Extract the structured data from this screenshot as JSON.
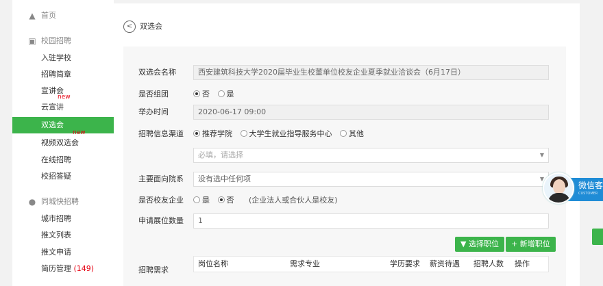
{
  "sidebar": {
    "home": "首页",
    "campus_group": "校园招聘",
    "items": [
      {
        "label": "入驻学校"
      },
      {
        "label": "招聘简章"
      },
      {
        "label": "宣讲会"
      },
      {
        "label": "云宣讲",
        "badge": "new"
      },
      {
        "label": "双选会"
      },
      {
        "label": "视频双选会",
        "badge": "new"
      },
      {
        "label": "在线招聘"
      },
      {
        "label": "校招答疑"
      }
    ],
    "city_group": "同城快招聘",
    "city_items": [
      {
        "label": "城市招聘"
      },
      {
        "label": "推文列表"
      },
      {
        "label": "推文申请"
      },
      {
        "label": "简历管理",
        "count": "(149)"
      }
    ]
  },
  "page": {
    "title": "双选会"
  },
  "form": {
    "name_label": "双选会名称",
    "name_value": "西安建筑科技大学2020届毕业生校董单位校友企业夏季就业洽谈会（6月17日）",
    "group_label": "是否组团",
    "group_no": "否",
    "group_yes": "是",
    "time_label": "举办时间",
    "time_value": "2020-06-17 09:00",
    "channel_label": "招聘信息渠道",
    "channel_opts": [
      "推荐学院",
      "大学生就业指导服务中心",
      "其他"
    ],
    "channel_placeholder": "必填，请选择",
    "dept_label": "主要面向院系",
    "dept_placeholder": "没有选中任何项",
    "alumni_label": "是否校友企业",
    "alumni_yes": "是",
    "alumni_no": "否",
    "alumni_note": "(企业法人或合伙人是校友)",
    "booth_label": "申请展位数量",
    "booth_value": "1",
    "btn_select": "选择职位",
    "btn_add": "新增职位",
    "demand_label": "招聘需求",
    "table_cols": [
      "岗位名称",
      "需求专业",
      "学历要求",
      "薪资待遇",
      "招聘人数",
      "操作"
    ]
  },
  "widget": {
    "text": "微信客",
    "sub": "CUSTOMER"
  },
  "colors": {
    "accent": "#3cb44b",
    "badge": "#e60012",
    "widget": "#1f8cd6"
  }
}
